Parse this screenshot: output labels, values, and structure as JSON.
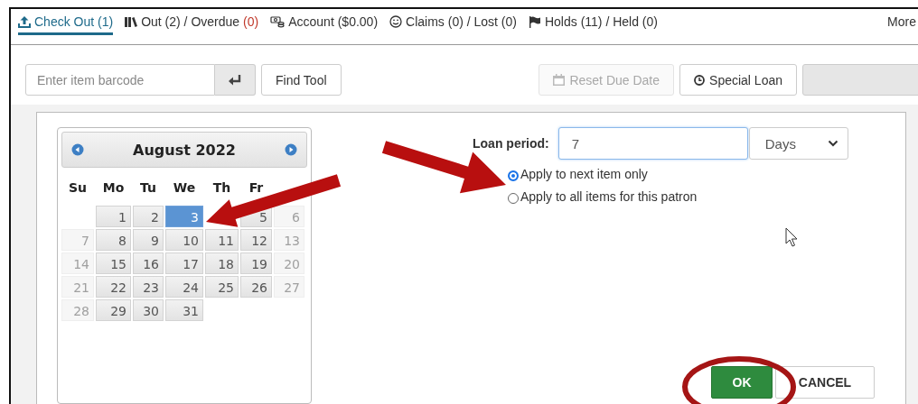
{
  "tabs": [
    {
      "label": "Check Out (1)",
      "selected": true
    },
    {
      "label": "Out (2) / Overdue",
      "alert": "(0)",
      "selected": false
    },
    {
      "label": "Account ($0.00)",
      "selected": false
    },
    {
      "label": "Claims (0) / Lost (0)",
      "selected": false
    },
    {
      "label": "Holds (11) / Held (0)",
      "selected": false
    }
  ],
  "more": "More",
  "toolbar": {
    "barcode_placeholder": "Enter item barcode",
    "find_button": "Find Tool",
    "reset_button": {
      "label": "Reset Due Date",
      "disabled": true
    },
    "special_loan_button": "Special Loan"
  },
  "calendar": {
    "month": "August 2022",
    "weekdays": [
      "Su",
      "Mo",
      "Tu",
      "We",
      "Th",
      "Fr"
    ],
    "weeks": [
      [
        {
          "kind": "blank"
        },
        {
          "kind": "day",
          "d": "1",
          "selected": false
        },
        {
          "kind": "day",
          "d": "2",
          "selected": false
        },
        {
          "kind": "day",
          "d": "3",
          "selected": true
        },
        {
          "kind": "covered"
        },
        {
          "kind": "day",
          "d": "5",
          "selected": false
        },
        {
          "kind": "muted",
          "d": "6"
        }
      ],
      [
        {
          "kind": "muted",
          "d": "7"
        },
        {
          "kind": "day",
          "d": "8",
          "selected": false
        },
        {
          "kind": "day",
          "d": "9",
          "selected": false
        },
        {
          "kind": "day",
          "d": "10",
          "selected": false
        },
        {
          "kind": "day",
          "d": "11",
          "selected": false
        },
        {
          "kind": "day",
          "d": "12",
          "selected": false
        },
        {
          "kind": "muted",
          "d": "13"
        }
      ],
      [
        {
          "kind": "muted",
          "d": "14"
        },
        {
          "kind": "day",
          "d": "15",
          "selected": false
        },
        {
          "kind": "day",
          "d": "16",
          "selected": false
        },
        {
          "kind": "day",
          "d": "17",
          "selected": false
        },
        {
          "kind": "day",
          "d": "18",
          "selected": false
        },
        {
          "kind": "day",
          "d": "19",
          "selected": false
        },
        {
          "kind": "muted",
          "d": "20"
        }
      ],
      [
        {
          "kind": "muted",
          "d": "21"
        },
        {
          "kind": "day",
          "d": "22",
          "selected": false
        },
        {
          "kind": "day",
          "d": "23",
          "selected": false
        },
        {
          "kind": "day",
          "d": "24",
          "selected": false
        },
        {
          "kind": "day",
          "d": "25",
          "selected": false
        },
        {
          "kind": "day",
          "d": "26",
          "selected": false
        },
        {
          "kind": "muted",
          "d": "27"
        }
      ],
      [
        {
          "kind": "muted",
          "d": "28"
        },
        {
          "kind": "day",
          "d": "29",
          "selected": false
        },
        {
          "kind": "day",
          "d": "30",
          "selected": false
        },
        {
          "kind": "day",
          "d": "31",
          "selected": false
        },
        {
          "kind": "blank"
        },
        {
          "kind": "blank"
        },
        {
          "kind": "blank"
        }
      ]
    ]
  },
  "loan": {
    "label": "Loan period:",
    "value": "7",
    "unit": "Days",
    "options": [
      {
        "label": "Apply to next item only",
        "selected": true
      },
      {
        "label": "Apply to all items for this patron",
        "selected": false
      }
    ]
  },
  "dialog_buttons": {
    "ok": "OK",
    "cancel": "CANCEL"
  }
}
